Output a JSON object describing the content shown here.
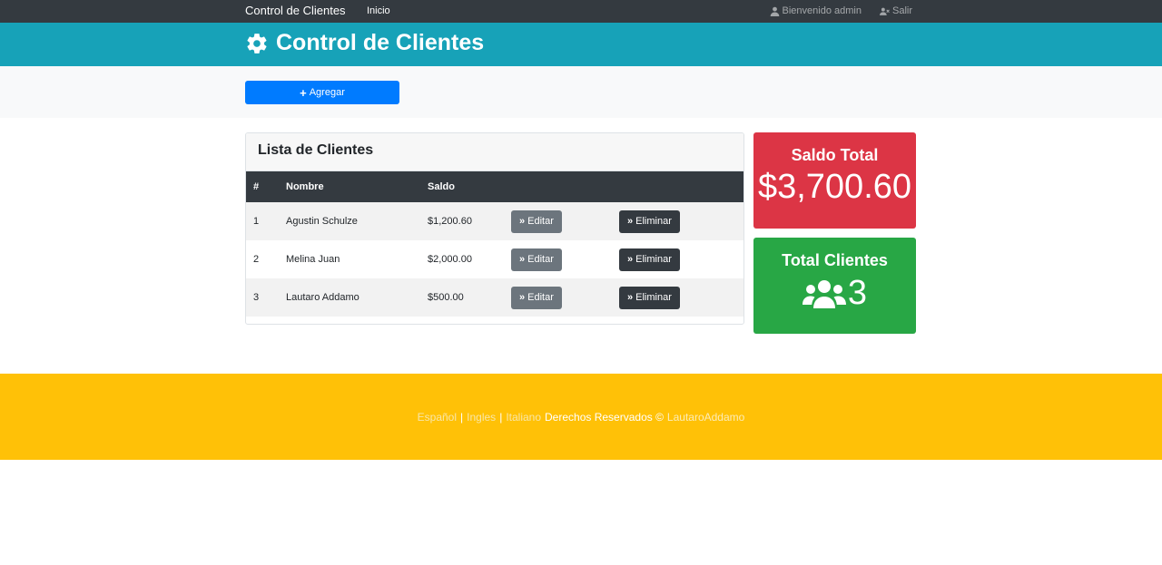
{
  "navbar": {
    "brand": "Control de Clientes",
    "home_link": "Inicio",
    "welcome": "Bienvenido admin",
    "logout": "Salir"
  },
  "header": {
    "title": "Control de Clientes",
    "icon": "gear-icon"
  },
  "actions": {
    "add_label": "Agregar"
  },
  "clients_card": {
    "title": "Lista de Clientes",
    "columns": [
      "#",
      "Nombre",
      "Saldo"
    ],
    "edit_label": "Editar",
    "delete_label": "Eliminar",
    "rows": [
      {
        "num": "1",
        "name": "Agustin Schulze",
        "saldo": "$1,200.60"
      },
      {
        "num": "2",
        "name": "Melina Juan",
        "saldo": "$2,000.00"
      },
      {
        "num": "3",
        "name": "Lautaro Addamo",
        "saldo": "$500.00"
      }
    ]
  },
  "stats": {
    "saldo_title": "Saldo Total",
    "saldo_value": "$3,700.60",
    "clients_title": "Total Clientes",
    "clients_value": "3"
  },
  "footer": {
    "lang_es": "Español",
    "lang_en": "Ingles",
    "lang_it": "Italiano",
    "rights": "Derechos Reservados ©",
    "author": "LautaroAddamo",
    "separator": "|"
  },
  "colors": {
    "navbar": "#343a40",
    "header": "#17a2b8",
    "primary": "#007bff",
    "danger": "#dc3545",
    "success": "#28a745",
    "warning": "#ffc107"
  }
}
